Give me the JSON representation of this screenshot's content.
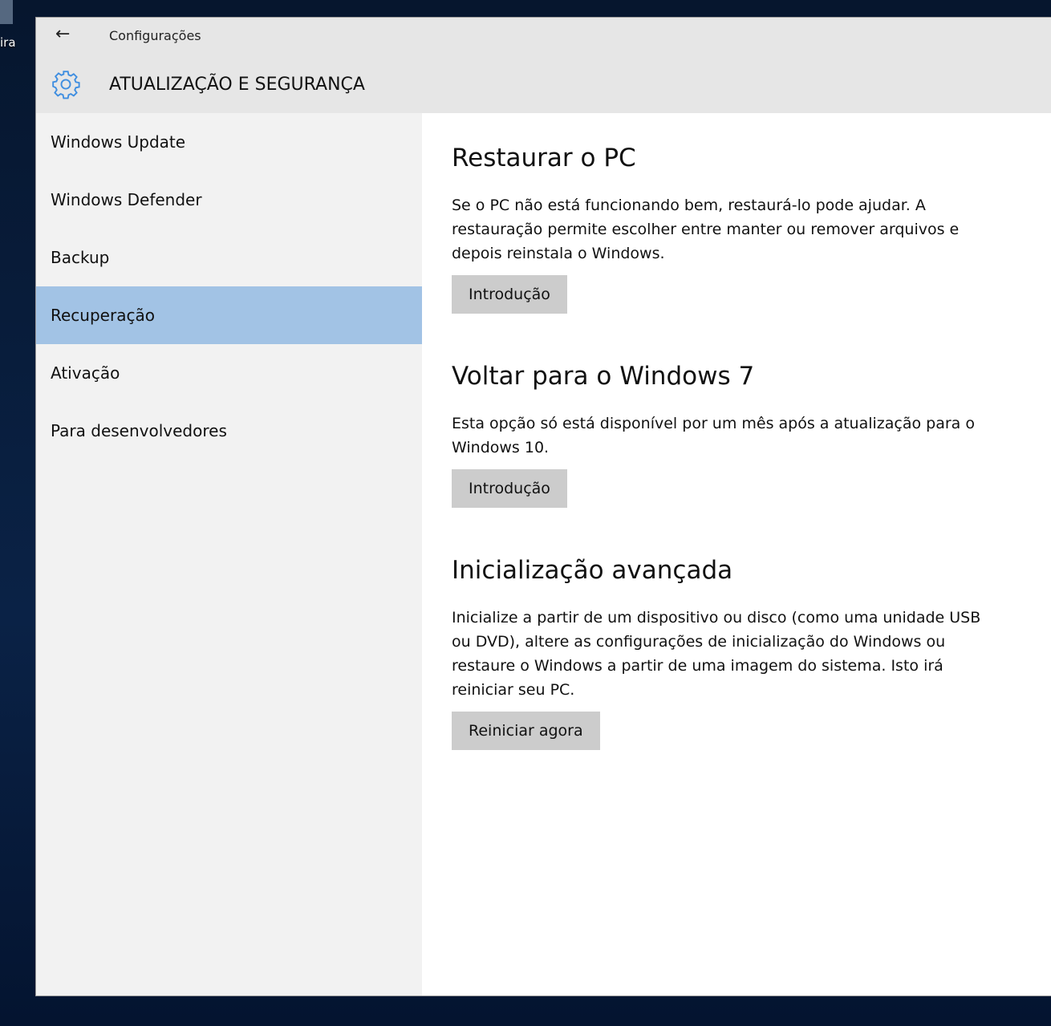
{
  "desktop": {
    "icon_label": "ira"
  },
  "header": {
    "app_title": "Configurações",
    "section_title": "ATUALIZAÇÃO E SEGURANÇA",
    "accent": "#3f8ee0"
  },
  "sidebar": {
    "items": [
      {
        "label": "Windows Update"
      },
      {
        "label": "Windows Defender"
      },
      {
        "label": "Backup"
      },
      {
        "label": "Recuperação",
        "selected": true
      },
      {
        "label": "Ativação"
      },
      {
        "label": "Para desenvolvedores"
      }
    ]
  },
  "main": {
    "sections": [
      {
        "title": "Restaurar o PC",
        "text": "Se o PC não está funcionando bem, restaurá-lo pode ajudar. A restauração permite escolher entre manter ou remover arquivos e depois reinstala o Windows.",
        "button": "Introdução"
      },
      {
        "title": "Voltar para o Windows 7",
        "text": "Esta opção só está disponível por um mês após a atualização para o Windows 10.",
        "button": "Introdução"
      },
      {
        "title": "Inicialização avançada",
        "text": "Inicialize a partir de um dispositivo ou disco (como uma unidade USB ou DVD), altere as configurações de inicialização do Windows ou restaure o Windows a partir de uma imagem do sistema. Isto irá reiniciar seu PC.",
        "button": "Reiniciar agora"
      }
    ]
  }
}
